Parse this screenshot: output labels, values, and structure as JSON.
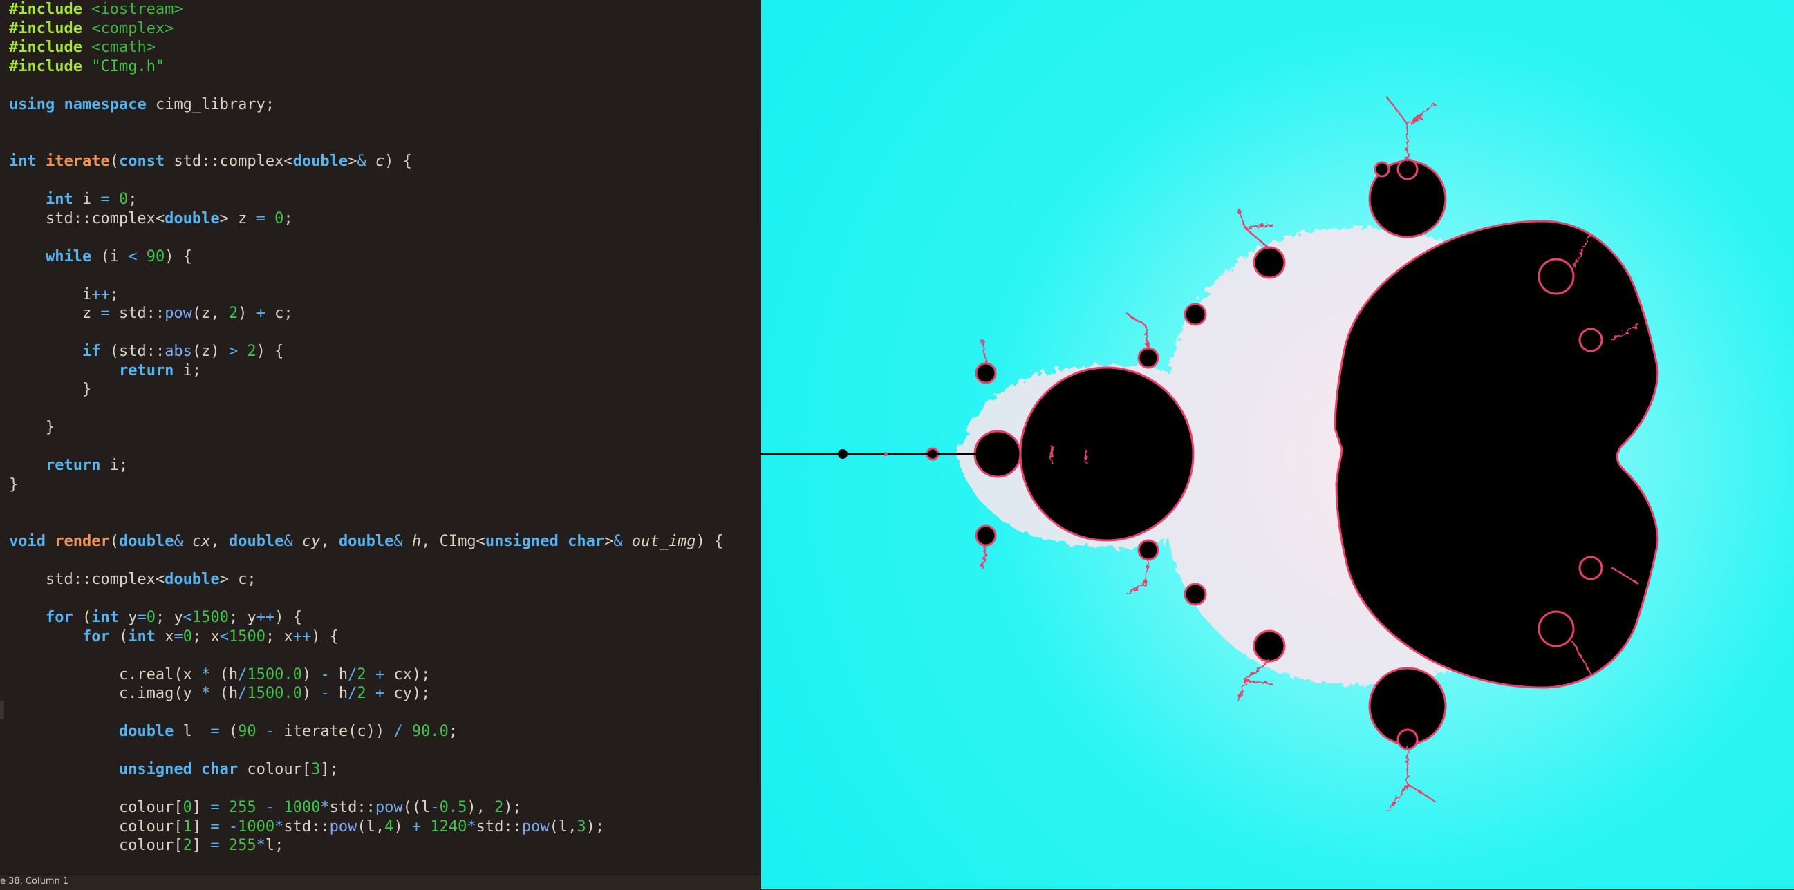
{
  "editor": {
    "lines": [
      [
        {
          "t": "#include",
          "c": "pp"
        },
        {
          "t": " "
        },
        {
          "t": "<iostream>",
          "c": "inc"
        }
      ],
      [
        {
          "t": "#include",
          "c": "pp"
        },
        {
          "t": " "
        },
        {
          "t": "<complex>",
          "c": "inc"
        }
      ],
      [
        {
          "t": "#include",
          "c": "pp"
        },
        {
          "t": " "
        },
        {
          "t": "<cmath>",
          "c": "inc"
        }
      ],
      [
        {
          "t": "#include",
          "c": "pp"
        },
        {
          "t": " "
        },
        {
          "t": "\"CImg.h\"",
          "c": "str"
        }
      ],
      [],
      [
        {
          "t": "using",
          "c": "kw"
        },
        {
          "t": " "
        },
        {
          "t": "namespace",
          "c": "kw"
        },
        {
          "t": " cimg_library;"
        }
      ],
      [],
      [],
      [
        {
          "t": "int",
          "c": "kw"
        },
        {
          "t": " "
        },
        {
          "t": "iterate",
          "c": "fn"
        },
        {
          "t": "("
        },
        {
          "t": "const",
          "c": "kw"
        },
        {
          "t": " std::complex<"
        },
        {
          "t": "double",
          "c": "kw"
        },
        {
          "t": ">"
        },
        {
          "t": "&",
          "c": "op"
        },
        {
          "t": " "
        },
        {
          "t": "c",
          "c": "par"
        },
        {
          "t": ") {"
        }
      ],
      [],
      [
        {
          "t": "    "
        },
        {
          "t": "int",
          "c": "kw"
        },
        {
          "t": " i "
        },
        {
          "t": "=",
          "c": "op"
        },
        {
          "t": " "
        },
        {
          "t": "0",
          "c": "num"
        },
        {
          "t": ";"
        }
      ],
      [
        {
          "t": "    std::complex<"
        },
        {
          "t": "double",
          "c": "kw"
        },
        {
          "t": "> z "
        },
        {
          "t": "=",
          "c": "op"
        },
        {
          "t": " "
        },
        {
          "t": "0",
          "c": "num"
        },
        {
          "t": ";"
        }
      ],
      [],
      [
        {
          "t": "    "
        },
        {
          "t": "while",
          "c": "kw"
        },
        {
          "t": " (i "
        },
        {
          "t": "<",
          "c": "op"
        },
        {
          "t": " "
        },
        {
          "t": "90",
          "c": "num"
        },
        {
          "t": ") {"
        }
      ],
      [],
      [
        {
          "t": "        i"
        },
        {
          "t": "++",
          "c": "op"
        },
        {
          "t": ";"
        }
      ],
      [
        {
          "t": "        z "
        },
        {
          "t": "=",
          "c": "op"
        },
        {
          "t": " std::"
        },
        {
          "t": "pow",
          "c": "call"
        },
        {
          "t": "(z, "
        },
        {
          "t": "2",
          "c": "num"
        },
        {
          "t": ") "
        },
        {
          "t": "+",
          "c": "op"
        },
        {
          "t": " c;"
        }
      ],
      [],
      [
        {
          "t": "        "
        },
        {
          "t": "if",
          "c": "kw"
        },
        {
          "t": " (std::"
        },
        {
          "t": "abs",
          "c": "call"
        },
        {
          "t": "(z) "
        },
        {
          "t": ">",
          "c": "op"
        },
        {
          "t": " "
        },
        {
          "t": "2",
          "c": "num"
        },
        {
          "t": ") {"
        }
      ],
      [
        {
          "t": "            "
        },
        {
          "t": "return",
          "c": "kw"
        },
        {
          "t": " i;"
        }
      ],
      [
        {
          "t": "        }"
        }
      ],
      [],
      [
        {
          "t": "    }"
        }
      ],
      [],
      [
        {
          "t": "    "
        },
        {
          "t": "return",
          "c": "kw"
        },
        {
          "t": " i;"
        }
      ],
      [
        {
          "t": "}"
        }
      ],
      [],
      [],
      [
        {
          "t": "void",
          "c": "kw"
        },
        {
          "t": " "
        },
        {
          "t": "render",
          "c": "fn"
        },
        {
          "t": "("
        },
        {
          "t": "double",
          "c": "kw"
        },
        {
          "t": "&",
          "c": "op"
        },
        {
          "t": " "
        },
        {
          "t": "cx",
          "c": "par"
        },
        {
          "t": ", "
        },
        {
          "t": "double",
          "c": "kw"
        },
        {
          "t": "&",
          "c": "op"
        },
        {
          "t": " "
        },
        {
          "t": "cy",
          "c": "par"
        },
        {
          "t": ", "
        },
        {
          "t": "double",
          "c": "kw"
        },
        {
          "t": "&",
          "c": "op"
        },
        {
          "t": " "
        },
        {
          "t": "h",
          "c": "par"
        },
        {
          "t": ", CImg<"
        },
        {
          "t": "unsigned",
          "c": "kw"
        },
        {
          "t": " "
        },
        {
          "t": "char",
          "c": "kw"
        },
        {
          "t": ">"
        },
        {
          "t": "&",
          "c": "op"
        },
        {
          "t": " "
        },
        {
          "t": "out_img",
          "c": "par"
        },
        {
          "t": ") {"
        }
      ],
      [],
      [
        {
          "t": "    std::complex<"
        },
        {
          "t": "double",
          "c": "kw"
        },
        {
          "t": "> c;"
        }
      ],
      [],
      [
        {
          "t": "    "
        },
        {
          "t": "for",
          "c": "kw"
        },
        {
          "t": " ("
        },
        {
          "t": "int",
          "c": "kw"
        },
        {
          "t": " y"
        },
        {
          "t": "=",
          "c": "op"
        },
        {
          "t": "0",
          "c": "num"
        },
        {
          "t": "; y"
        },
        {
          "t": "<",
          "c": "op"
        },
        {
          "t": "1500",
          "c": "num"
        },
        {
          "t": "; y"
        },
        {
          "t": "++",
          "c": "op"
        },
        {
          "t": ") {"
        }
      ],
      [
        {
          "t": "        "
        },
        {
          "t": "for",
          "c": "kw"
        },
        {
          "t": " ("
        },
        {
          "t": "int",
          "c": "kw"
        },
        {
          "t": " x"
        },
        {
          "t": "=",
          "c": "op"
        },
        {
          "t": "0",
          "c": "num"
        },
        {
          "t": "; x"
        },
        {
          "t": "<",
          "c": "op"
        },
        {
          "t": "1500",
          "c": "num"
        },
        {
          "t": "; x"
        },
        {
          "t": "++",
          "c": "op"
        },
        {
          "t": ") {"
        }
      ],
      [],
      [
        {
          "t": "            c.real(x "
        },
        {
          "t": "*",
          "c": "op"
        },
        {
          "t": " (h"
        },
        {
          "t": "/",
          "c": "op"
        },
        {
          "t": "1500.0",
          "c": "num"
        },
        {
          "t": ") "
        },
        {
          "t": "-",
          "c": "op"
        },
        {
          "t": " h"
        },
        {
          "t": "/",
          "c": "op"
        },
        {
          "t": "2",
          "c": "num"
        },
        {
          "t": " "
        },
        {
          "t": "+",
          "c": "op"
        },
        {
          "t": " cx);"
        }
      ],
      [
        {
          "t": "            c.imag(y "
        },
        {
          "t": "*",
          "c": "op"
        },
        {
          "t": " (h"
        },
        {
          "t": "/",
          "c": "op"
        },
        {
          "t": "1500.0",
          "c": "num"
        },
        {
          "t": ") "
        },
        {
          "t": "-",
          "c": "op"
        },
        {
          "t": " h"
        },
        {
          "t": "/",
          "c": "op"
        },
        {
          "t": "2",
          "c": "num"
        },
        {
          "t": " "
        },
        {
          "t": "+",
          "c": "op"
        },
        {
          "t": " cy);"
        }
      ],
      [],
      [
        {
          "t": "            "
        },
        {
          "t": "double",
          "c": "kw"
        },
        {
          "t": " l  "
        },
        {
          "t": "=",
          "c": "op"
        },
        {
          "t": " ("
        },
        {
          "t": "90",
          "c": "num"
        },
        {
          "t": " "
        },
        {
          "t": "-",
          "c": "op"
        },
        {
          "t": " iterate(c)) "
        },
        {
          "t": "/",
          "c": "op"
        },
        {
          "t": " "
        },
        {
          "t": "90.0",
          "c": "num"
        },
        {
          "t": ";"
        }
      ],
      [],
      [
        {
          "t": "            "
        },
        {
          "t": "unsigned",
          "c": "kw"
        },
        {
          "t": " "
        },
        {
          "t": "char",
          "c": "kw"
        },
        {
          "t": " colour["
        },
        {
          "t": "3",
          "c": "num"
        },
        {
          "t": "];"
        }
      ],
      [],
      [
        {
          "t": "            colour["
        },
        {
          "t": "0",
          "c": "num"
        },
        {
          "t": "] "
        },
        {
          "t": "=",
          "c": "op"
        },
        {
          "t": " "
        },
        {
          "t": "255",
          "c": "num"
        },
        {
          "t": " "
        },
        {
          "t": "-",
          "c": "op"
        },
        {
          "t": " "
        },
        {
          "t": "1000",
          "c": "num"
        },
        {
          "t": "*",
          "c": "op"
        },
        {
          "t": "std::"
        },
        {
          "t": "pow",
          "c": "call"
        },
        {
          "t": "((l"
        },
        {
          "t": "-",
          "c": "op"
        },
        {
          "t": "0.5",
          "c": "num"
        },
        {
          "t": "), "
        },
        {
          "t": "2",
          "c": "num"
        },
        {
          "t": ");"
        }
      ],
      [
        {
          "t": "            colour["
        },
        {
          "t": "1",
          "c": "num"
        },
        {
          "t": "] "
        },
        {
          "t": "=",
          "c": "op"
        },
        {
          "t": " "
        },
        {
          "t": "-",
          "c": "op"
        },
        {
          "t": "1000",
          "c": "num"
        },
        {
          "t": "*",
          "c": "op"
        },
        {
          "t": "std::"
        },
        {
          "t": "pow",
          "c": "call"
        },
        {
          "t": "(l,"
        },
        {
          "t": "4",
          "c": "num"
        },
        {
          "t": ") "
        },
        {
          "t": "+",
          "c": "op"
        },
        {
          "t": " "
        },
        {
          "t": "1240",
          "c": "num"
        },
        {
          "t": "*",
          "c": "op"
        },
        {
          "t": "std::"
        },
        {
          "t": "pow",
          "c": "call"
        },
        {
          "t": "(l,"
        },
        {
          "t": "3",
          "c": "num"
        },
        {
          "t": ");"
        }
      ],
      [
        {
          "t": "            colour["
        },
        {
          "t": "2",
          "c": "num"
        },
        {
          "t": "] "
        },
        {
          "t": "=",
          "c": "op"
        },
        {
          "t": " "
        },
        {
          "t": "255",
          "c": "num"
        },
        {
          "t": "*",
          "c": "op"
        },
        {
          "t": "l;"
        }
      ]
    ]
  },
  "statusbar": {
    "text": "e 38, Column 1"
  },
  "colors": {
    "editor_bg": "#231e1c",
    "keyword": "#58b3ee",
    "preprocessor": "#a8e33a",
    "string": "#3fce3f",
    "number": "#42c54a",
    "function_name": "#f19456",
    "fractal_background": "#1cf3f2",
    "fractal_set": "#000000",
    "fractal_edge": "#e8406a"
  }
}
